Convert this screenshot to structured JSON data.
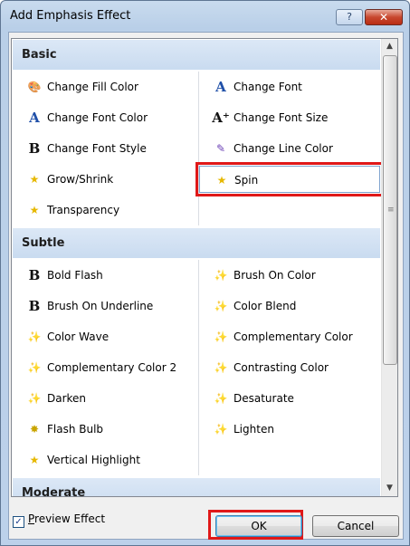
{
  "window": {
    "title": "Add Emphasis Effect",
    "help_label": "?",
    "close_label": "✕"
  },
  "groups": [
    {
      "label": "Basic",
      "items": [
        {
          "label": "Change Fill Color",
          "icon": "paint-bucket-icon",
          "glyph": "🎨",
          "color": "#2a6bb3"
        },
        {
          "label": "Change Font",
          "icon": "font-a-icon",
          "glyph": "A",
          "color": "#1f4fa8"
        },
        {
          "label": "Change Font Color",
          "icon": "font-color-icon",
          "glyph": "A",
          "color": "#1f4fa8"
        },
        {
          "label": "Change Font Size",
          "icon": "font-size-icon",
          "glyph": "A⁺",
          "color": "#111111"
        },
        {
          "label": "Change Font Style",
          "icon": "bold-b-icon",
          "glyph": "B",
          "color": "#111111"
        },
        {
          "label": "Change Line Color",
          "icon": "pen-line-icon",
          "glyph": "✎",
          "color": "#6a3fb5"
        },
        {
          "label": "Grow/Shrink",
          "icon": "star-grow-icon",
          "glyph": "★",
          "color": "#e6b800"
        },
        {
          "label": "Spin",
          "icon": "star-spin-icon",
          "glyph": "★",
          "color": "#e6b800",
          "selected": true
        },
        {
          "label": "Transparency",
          "icon": "star-transparency-icon",
          "glyph": "★",
          "color": "#e6b800"
        }
      ]
    },
    {
      "label": "Subtle",
      "items": [
        {
          "label": "Bold Flash",
          "icon": "bold-b-icon",
          "glyph": "B",
          "color": "#111111"
        },
        {
          "label": "Brush On Color",
          "icon": "star-sparkle-icon",
          "glyph": "✨",
          "color": "#2a9d3a"
        },
        {
          "label": "Brush On Underline",
          "icon": "bold-b-icon",
          "glyph": "B",
          "color": "#111111"
        },
        {
          "label": "Color Blend",
          "icon": "star-sparkle-icon",
          "glyph": "✨",
          "color": "#2a9d3a"
        },
        {
          "label": "Color Wave",
          "icon": "star-sparkle-icon",
          "glyph": "✨",
          "color": "#2a9d3a"
        },
        {
          "label": "Complementary Color",
          "icon": "star-sparkle-icon",
          "glyph": "✨",
          "color": "#2a9d3a"
        },
        {
          "label": "Complementary Color 2",
          "icon": "star-sparkle-icon",
          "glyph": "✨",
          "color": "#2a9d3a"
        },
        {
          "label": "Contrasting Color",
          "icon": "star-sparkle-icon",
          "glyph": "✨",
          "color": "#2a9d3a"
        },
        {
          "label": "Darken",
          "icon": "star-sparkle-icon",
          "glyph": "✨",
          "color": "#2a9d3a"
        },
        {
          "label": "Desaturate",
          "icon": "star-sparkle-icon",
          "glyph": "✨",
          "color": "#2a9d3a"
        },
        {
          "label": "Flash Bulb",
          "icon": "flash-bulb-icon",
          "glyph": "✸",
          "color": "#c9a400"
        },
        {
          "label": "Lighten",
          "icon": "star-sparkle-icon",
          "glyph": "✨",
          "color": "#2a9d3a"
        },
        {
          "label": "Vertical Highlight",
          "icon": "star-highlight-icon",
          "glyph": "★",
          "color": "#e6b800"
        }
      ]
    },
    {
      "label": "Moderate",
      "items": []
    }
  ],
  "footer": {
    "preview_label": "Preview Effect",
    "preview_checked": true,
    "ok_label": "OK",
    "cancel_label": "Cancel"
  },
  "scrollbar": {
    "up_arrow": "▲",
    "down_arrow": "▼",
    "grip": "≡"
  }
}
